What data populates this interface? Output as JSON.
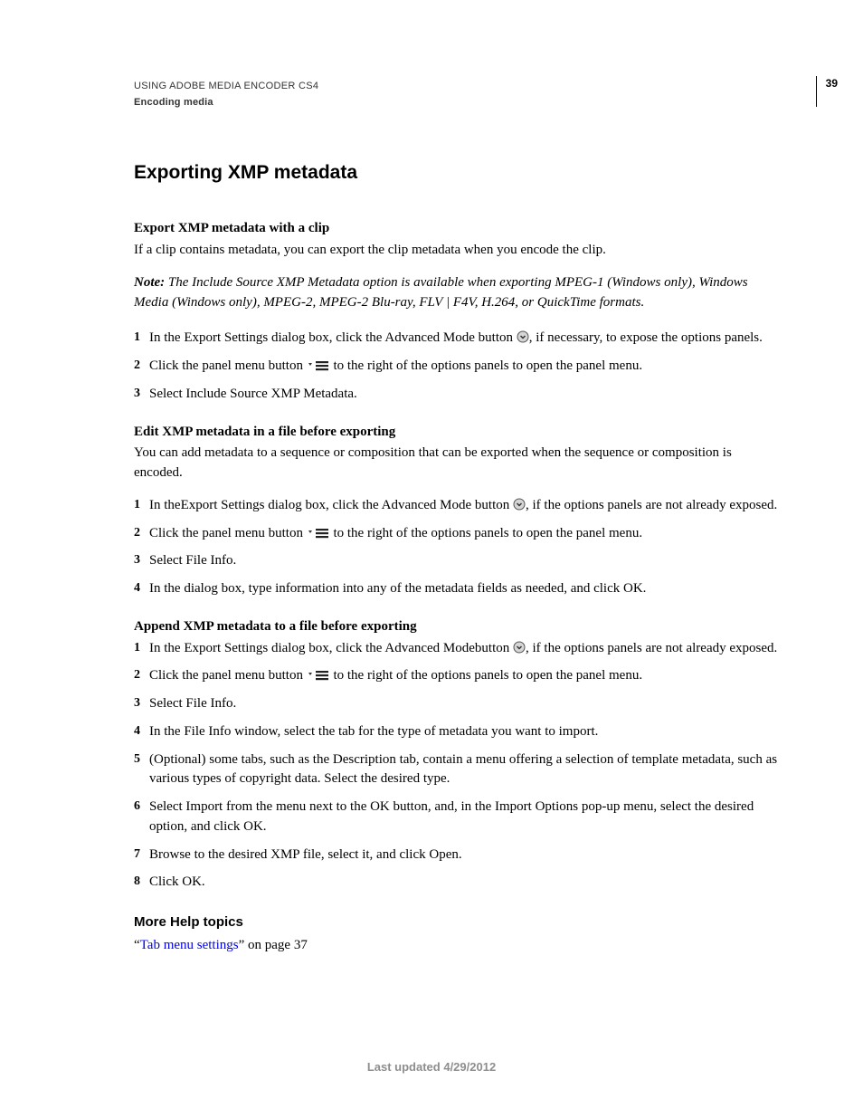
{
  "header": {
    "running_head": "USING ADOBE MEDIA ENCODER CS4",
    "section": "Encoding media",
    "page_number": "39"
  },
  "h1": "Exporting XMP metadata",
  "sec1": {
    "heading": "Export XMP metadata with a clip",
    "intro": "If a clip contains metadata, you can export the clip metadata when you encode the clip.",
    "note_label": "Note: ",
    "note_body": "The Include Source XMP Metadata option is available when exporting MPEG-1 (Windows only), Windows Media (Windows only), MPEG-2, MPEG-2 Blu-ray, FLV | F4V, H.264, or QuickTime formats.",
    "step1a": "In the Export Settings dialog box, click the Advanced Mode button ",
    "step1b": ", if necessary, to expose the options panels.",
    "step2a": "Click the panel menu button ",
    "step2b": " to the right of the options panels to open the panel menu.",
    "step3": "Select Include Source XMP Metadata."
  },
  "sec2": {
    "heading": "Edit XMP metadata in a file before exporting",
    "intro": "You can add metadata to a sequence or composition that can be exported when the sequence or composition is encoded.",
    "step1a": "In theExport Settings dialog box, click the Advanced Mode button ",
    "step1b": ", if the options panels are not already exposed.",
    "step2a": "Click the panel menu button ",
    "step2b": " to the right of the options panels to open the panel menu.",
    "step3": "Select File Info.",
    "step4": "In the dialog box, type information into any of the metadata fields as needed, and click OK."
  },
  "sec3": {
    "heading": "Append XMP metadata to a file before exporting",
    "step1a": "In the Export Settings dialog box, click the Advanced Modebutton ",
    "step1b": ", if the options panels are not already exposed.",
    "step2a": "Click the panel menu button ",
    "step2b": " to the right of the options panels to open the panel menu.",
    "step3": "Select File Info.",
    "step4": "In the File Info window, select the tab for the type of metadata you want to import.",
    "step5": "(Optional) some tabs, such as the Description tab, contain a menu offering a selection of template metadata, such as various types of copyright data. Select the desired type.",
    "step6": " Select Import from the menu next to the OK button, and, in the Import Options pop-up menu, select the desired option, and click OK.",
    "step7": "Browse to the desired XMP file, select it, and click Open.",
    "step8": "Click OK."
  },
  "more_help": {
    "heading": "More Help topics",
    "quote_open": "“",
    "link_text": "Tab menu settings",
    "quote_close_text": "” on page 37"
  },
  "footer": "Last updated 4/29/2012"
}
